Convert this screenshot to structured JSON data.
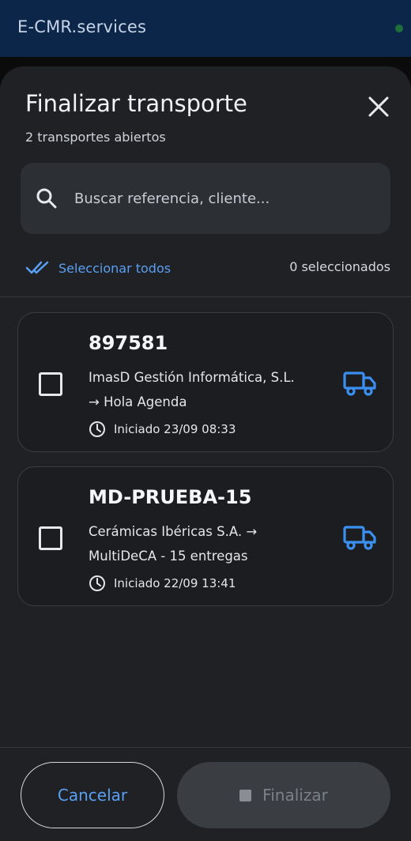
{
  "app": {
    "title": "E-CMR.services"
  },
  "sheet": {
    "title": "Finalizar transporte",
    "subtitle": "2 transportes abiertos",
    "search_placeholder": "Buscar referencia, cliente...",
    "select_all_label": "Seleccionar todos",
    "selected_count": "0 seleccionados"
  },
  "transports": [
    {
      "reference": "897581",
      "route_line1": "ImasD Gestión Informática, S.L.",
      "route_line2": "→ Hola Agenda",
      "started": "Iniciado 23/09 08:33",
      "checked": false
    },
    {
      "reference": "MD-PRUEBA-15",
      "route_line1": "Cerámicas Ibéricas S.A. →",
      "route_line2": "MultiDeCA - 15 entregas",
      "started": "Iniciado 22/09 13:41",
      "checked": false
    }
  ],
  "footer": {
    "cancel_label": "Cancelar",
    "finish_label": "Finalizar"
  },
  "colors": {
    "accent": "#3b8ff0",
    "app_bar": "#0c2649",
    "sheet_bg": "#1f2125",
    "status_dot": "#1f6f3a"
  },
  "icons": {
    "close": "close-icon",
    "search": "search-icon",
    "select_all": "double-check-icon",
    "clock": "clock-icon",
    "truck": "truck-icon",
    "stop": "stop-icon"
  }
}
